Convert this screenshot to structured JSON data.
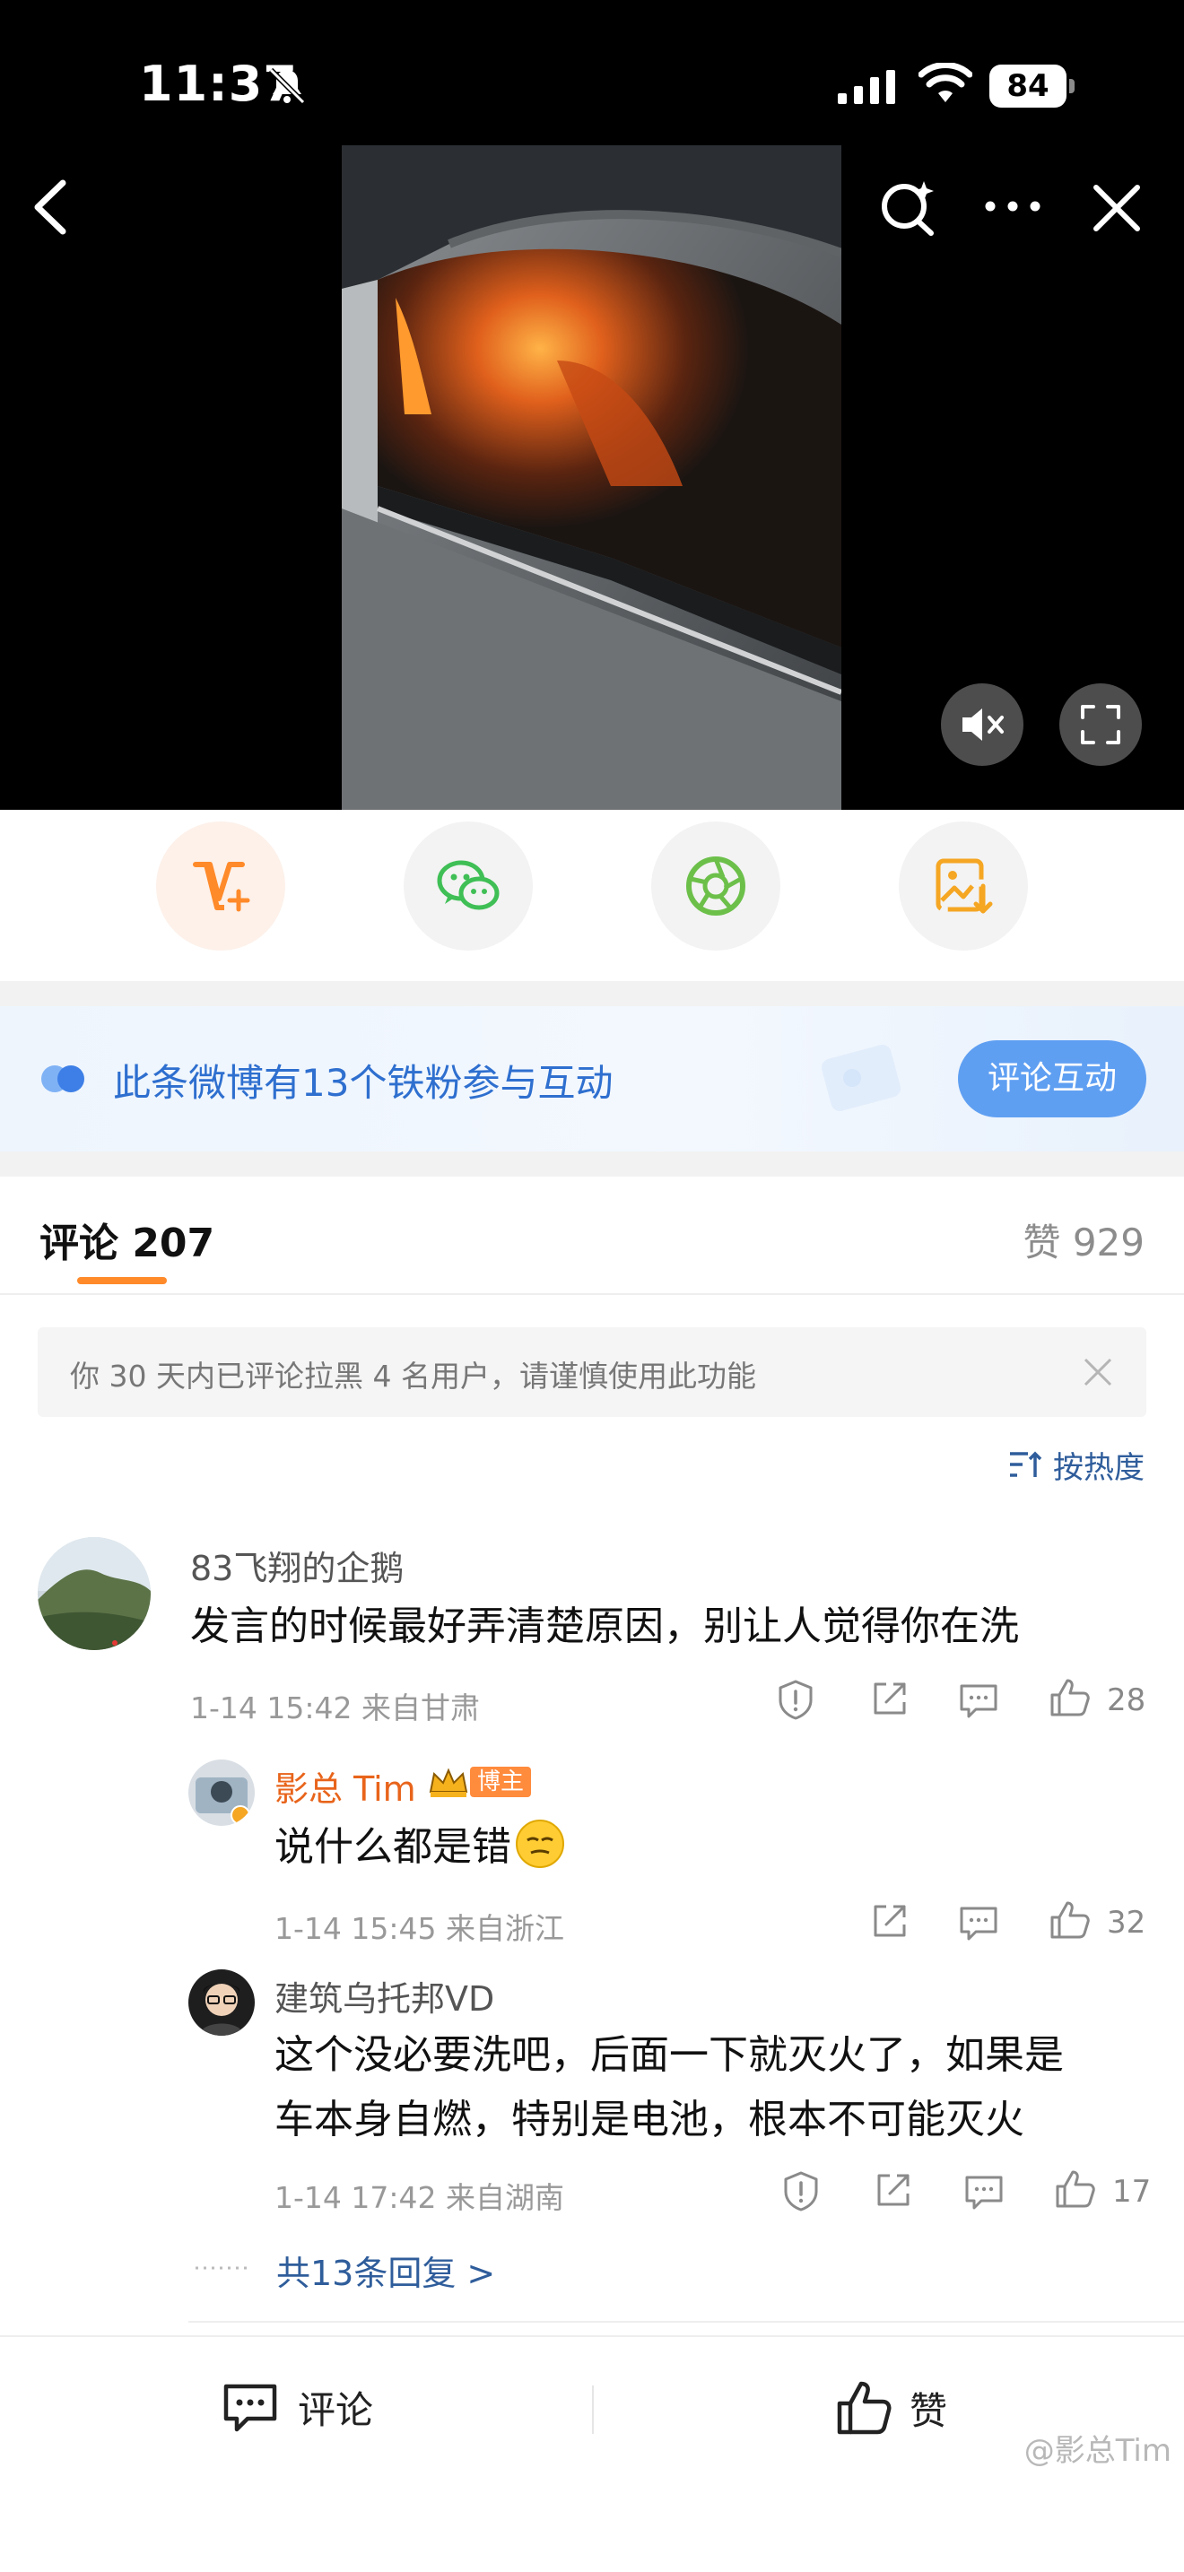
{
  "status_bar": {
    "time": "11:37",
    "battery": "84"
  },
  "fans_banner": {
    "text": "此条微博有13个铁粉参与互动",
    "button": "评论互动"
  },
  "comments_header": {
    "title": "评论 207",
    "likes": "赞 929"
  },
  "notice": {
    "text": "你 30 天内已评论拉黑 4 名用户，请谨慎使用此功能"
  },
  "sort": {
    "label": "按热度"
  },
  "comments": [
    {
      "user": "83飞翔的企鹅",
      "text": "发言的时候最好弄清楚原因，别让人觉得你在洗",
      "meta": "1-14 15:42  来自甘肃",
      "likes": "28",
      "replies": [
        {
          "user": "影总 Tim",
          "badge": "博主",
          "text": "说什么都是错",
          "meta": "1-14 15:45  来自浙江",
          "likes": "32",
          "name_color": "#e8641b"
        },
        {
          "user": "建筑乌托邦VD",
          "text_line1": "这个没必要洗吧，后面一下就灭火了，如果是",
          "text_line2": "车本身自燃，特别是电池，根本不可能灭火",
          "meta": "1-14 17:42  来自湖南",
          "likes": "17"
        }
      ],
      "more_replies": "共13条回复 >"
    }
  ],
  "bottom_bar": {
    "comment": "评论",
    "like": "赞"
  },
  "watermark": "@影总Tim",
  "colors": {
    "accent": "#ff8a2a",
    "link": "#2f5d9b",
    "blue_button": "#5f9ff2"
  }
}
